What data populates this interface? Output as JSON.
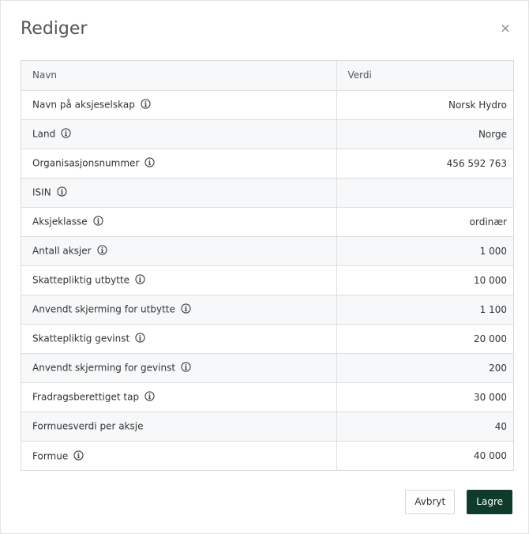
{
  "dialog": {
    "title": "Rediger",
    "close_glyph": "×"
  },
  "table": {
    "headers": {
      "name": "Navn",
      "value": "Verdi"
    },
    "rows": [
      {
        "label": "Navn på aksjeselskap",
        "value": "Norsk Hydro",
        "info": true
      },
      {
        "label": "Land",
        "value": "Norge",
        "info": true
      },
      {
        "label": "Organisasjonsnummer",
        "value": "456 592 763",
        "info": true
      },
      {
        "label": "ISIN",
        "value": "",
        "info": true
      },
      {
        "label": "Aksjeklasse",
        "value": "ordinær",
        "info": true
      },
      {
        "label": "Antall aksjer",
        "value": "1 000",
        "info": true
      },
      {
        "label": "Skattepliktig utbytte",
        "value": "10 000",
        "info": true
      },
      {
        "label": "Anvendt skjerming for utbytte",
        "value": "1 100",
        "info": true
      },
      {
        "label": "Skattepliktig gevinst",
        "value": "20 000",
        "info": true
      },
      {
        "label": "Anvendt skjerming for gevinst",
        "value": "200",
        "info": true
      },
      {
        "label": "Fradragsberettiget tap",
        "value": "30 000",
        "info": true
      },
      {
        "label": "Formuesverdi per aksje",
        "value": "40",
        "info": false
      },
      {
        "label": "Formue",
        "value": "40 000",
        "info": true
      }
    ]
  },
  "footer": {
    "cancel_label": "Avbryt",
    "save_label": "Lagre"
  },
  "colors": {
    "primary": "#0f3b2b",
    "stripe": "#f7f8f9",
    "border": "#dedede"
  }
}
